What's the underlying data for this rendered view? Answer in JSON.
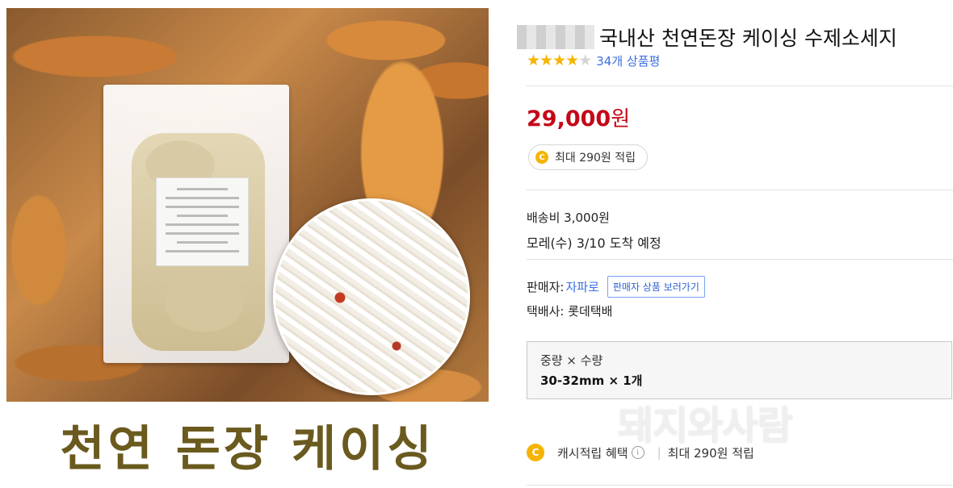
{
  "image": {
    "caption": "천연 돈장 케이싱"
  },
  "product": {
    "title": "국내산 천연돈장 케이싱 수제소세지",
    "rating_stars": 4,
    "review_count": "34개 상품평",
    "price": "29,000",
    "price_unit": "원",
    "reward_chip": "최대 290원 적립"
  },
  "shipping": {
    "fee": "배송비 3,000원",
    "arrival": "모레(수) 3/10 도착 예정"
  },
  "seller": {
    "label": "판매자: ",
    "name": "자파로",
    "button": "판매자 상품 보러가기",
    "courier": "택배사: 롯데택배"
  },
  "option": {
    "label": "중량 × 수량",
    "value": "30-32mm × 1개"
  },
  "watermark": "돼지와사람",
  "cash": {
    "label": "캐시적립 혜택",
    "info_icon": "i",
    "value": "최대 290원 적립"
  },
  "icons": {
    "coin_letter": "C"
  },
  "colors": {
    "price": "#c40818",
    "link": "#3a6fe0",
    "star": "#f6b400"
  }
}
